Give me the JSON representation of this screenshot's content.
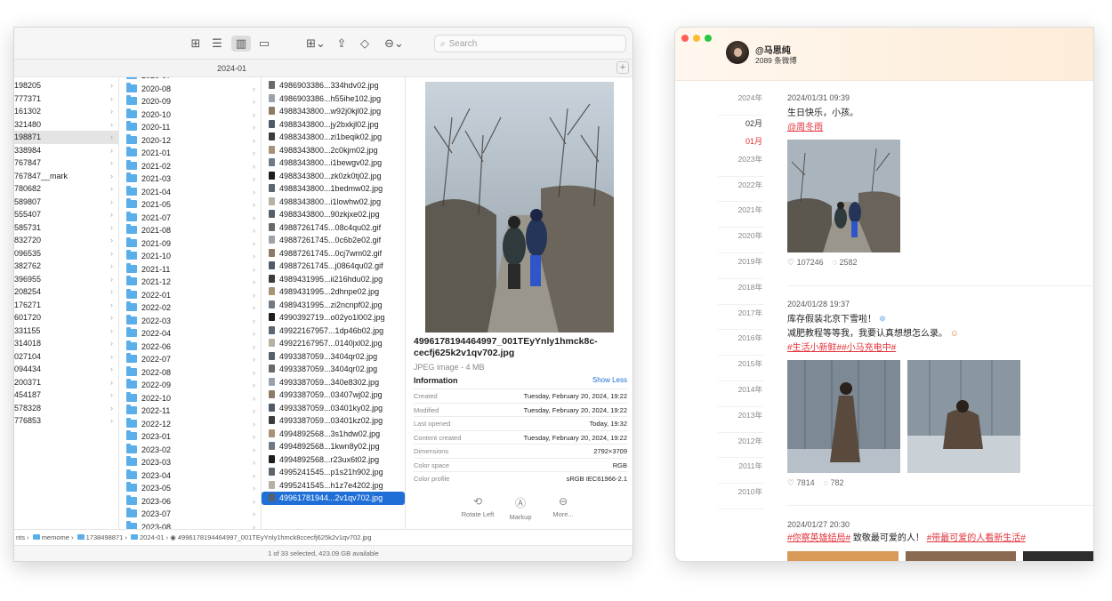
{
  "finder": {
    "path_title": "2024-01",
    "search_placeholder": "Search",
    "col1": [
      "198205",
      "777371",
      "161302",
      "321480",
      "198871",
      "338984",
      "767847",
      "767847__mark",
      "780682",
      "589807",
      "555407",
      "585731",
      "832720",
      "096535",
      "382762",
      "396955",
      "208254",
      "176271",
      "601720",
      "331155",
      "314018",
      "027104",
      "094434",
      "200371",
      "454187",
      "578328",
      "776853"
    ],
    "col2": [
      "2020-07",
      "2020-08",
      "2020-09",
      "2020-10",
      "2020-11",
      "2020-12",
      "2021-01",
      "2021-02",
      "2021-03",
      "2021-04",
      "2021-05",
      "2021-07",
      "2021-08",
      "2021-09",
      "2021-10",
      "2021-11",
      "2021-12",
      "2022-01",
      "2022-02",
      "2022-03",
      "2022-04",
      "2022-06",
      "2022-07",
      "2022-08",
      "2022-09",
      "2022-10",
      "2022-11",
      "2022-12",
      "2023-01",
      "2023-02",
      "2023-03",
      "2023-04",
      "2023-05",
      "2023-06",
      "2023-07",
      "2023-08"
    ],
    "col3": [
      "4986903386...334hdv02.jpg",
      "4986903386...h55ihe102.jpg",
      "4988343800...w92j0kjl02.jpg",
      "4988343800...jy2bxkjl02.jpg",
      "4988343800...zi1beqik02.jpg",
      "4988343800...2c0kjm02.jpg",
      "4988343800...i1bewgv02.jpg",
      "4988343800...zk0zk0tj02.jpg",
      "4988343800...1bedmw02.jpg",
      "4988343800...i1lowhw02.jpg",
      "4988343800...90zkjxe02.jpg",
      "49887261745...08c4qu02.gif",
      "49887261745...0c6b2e02.gif",
      "49887261745...0cj7wm02.gif",
      "49887261745...j0864qu02.gif",
      "4989431995...ii216hdu02.jpg",
      "4989431995...2dhnpe02.jpg",
      "4989431995...zi2ncnpf02.jpg",
      "4990392719...o02yo1l002.jpg",
      "49922167957...1dp46b02.jpg",
      "49922167957...0140jxl02.jpg",
      "4993387059...3404qr02.jpg",
      "4993387059...3404qr02.jpg",
      "4993387059...340e8302.jpg",
      "4993387059...03407wj02.jpg",
      "4993387059...03401ky02.jpg",
      "4993387059...03401kz02.jpg",
      "4994892568...3s1hdw02.jpg",
      "4994892568...1kwn8y02.jpg",
      "4994892568...r23ux6t02.jpg",
      "4995241545...p1s21h902.jpg",
      "4995241545...h1z7e4202.jpg",
      "49961781944...2v1qv702.jpg"
    ],
    "file_name": "4996178194464997_001TEyYnly1hmck8c-cecfj625k2v1qv702.jpg",
    "file_type": "JPEG image - 4 MB",
    "info_label": "Information",
    "show_less": "Show Less",
    "info": [
      {
        "k": "Created",
        "v": "Tuesday, February 20, 2024, 19:22"
      },
      {
        "k": "Modified",
        "v": "Tuesday, February 20, 2024, 19:22"
      },
      {
        "k": "Last opened",
        "v": "Today, 19:32"
      },
      {
        "k": "Content created",
        "v": "Tuesday, February 20, 2024, 19:22"
      },
      {
        "k": "Dimensions",
        "v": "2792×3709"
      },
      {
        "k": "Color space",
        "v": "RGB"
      },
      {
        "k": "Color profile",
        "v": "sRGB IEC61966-2.1"
      }
    ],
    "actions": {
      "rotate": "Rotate Left",
      "markup": "Markup",
      "more": "More..."
    },
    "crumbs": {
      "c0": "nts",
      "c1": "memome",
      "c2": "1738498871",
      "c3": "2024-01",
      "c4": "4996178194464997_001TEyYnly1hmck8ccecfj625k2v1qv702.jpg"
    },
    "status": "1 of 33 selected, 423.09 GB available"
  },
  "weibo": {
    "username": "@马思纯",
    "post_count": "2089 条微博",
    "years": [
      "2024年",
      "02月",
      "01月",
      "2023年",
      "2022年",
      "2021年",
      "2020年",
      "2019年",
      "2018年",
      "2017年",
      "2016年",
      "2015年",
      "2014年",
      "2013年",
      "2012年",
      "2011年",
      "2010年"
    ],
    "posts": [
      {
        "time": "2024/01/31 09:39",
        "text1": "生日快乐，小孩。",
        "link": "@周冬雨",
        "likes": "107246",
        "comments": "2582"
      },
      {
        "time": "2024/01/28 19:37",
        "text1": "库存假装北京下雪啦！",
        "text2": "减肥教程等等我，我要认真想想怎么录。",
        "link": "#生活小新鲜##小马充电中#",
        "likes": "7814",
        "comments": "782"
      },
      {
        "time": "2024/01/27 20:30",
        "link1": "#你察英雄结局#",
        "text1": " 致敬最可爱的人！",
        "link2": "#带最可爱的人看新生活#"
      }
    ]
  }
}
